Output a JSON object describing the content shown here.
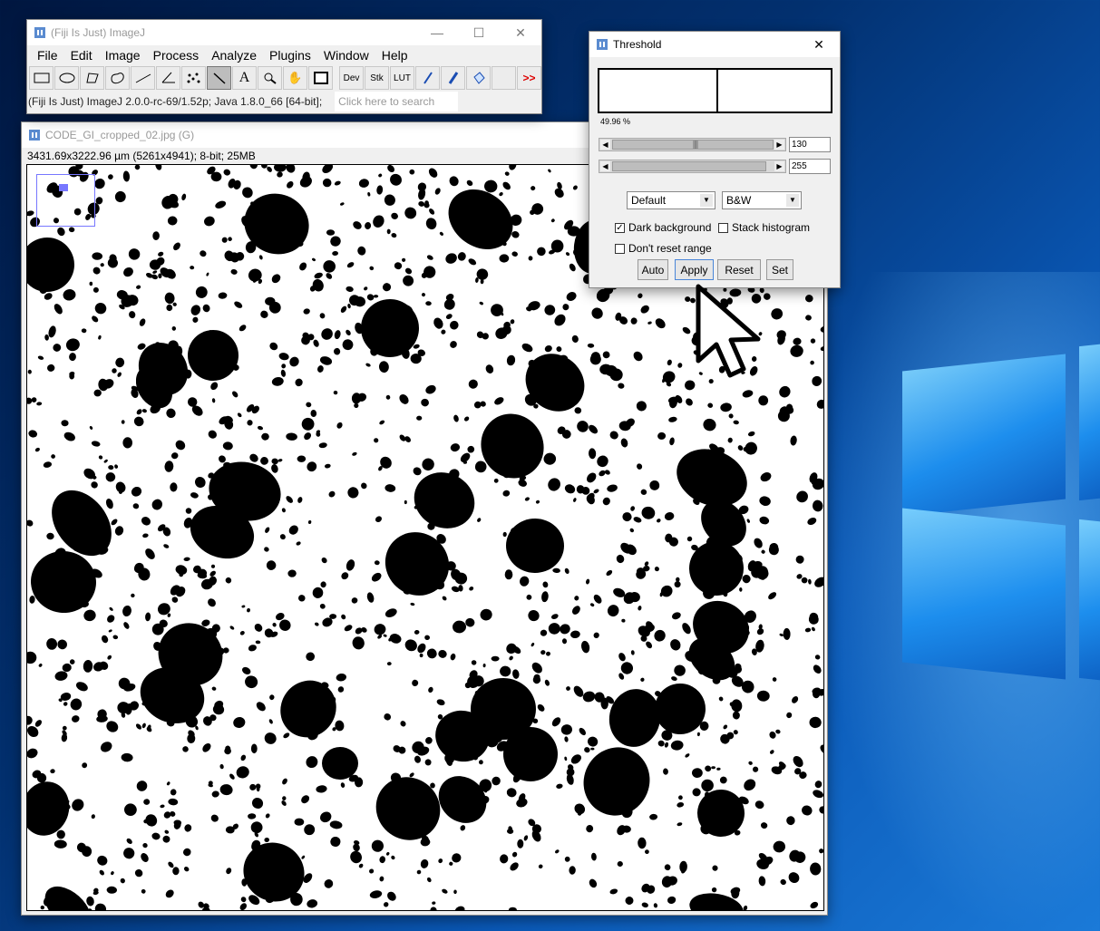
{
  "desktop": {
    "accent": "#0a58b6"
  },
  "imagej": {
    "title": "(Fiji Is Just) ImageJ",
    "menus": [
      "File",
      "Edit",
      "Image",
      "Process",
      "Analyze",
      "Plugins",
      "Window",
      "Help"
    ],
    "tools": [
      "rectangle-icon",
      "oval-icon",
      "polygon-icon",
      "freehand-icon",
      "line-icon",
      "angle-icon",
      "multipoint-icon",
      "wand-icon",
      "text-icon",
      "magnifier-icon",
      "hand-icon",
      "color-picker-icon",
      "Dev",
      "Stk",
      "LUT",
      "pencil-icon",
      "brush-icon",
      "flood-fill-icon",
      "more-tools-icon"
    ],
    "status": "(Fiji Is Just) ImageJ 2.0.0-rc-69/1.52p; Java 1.8.0_66 [64-bit];",
    "search_placeholder": "Click here to search",
    "dev_label": "Dev",
    "stk_label": "Stk",
    "lut_label": "LUT",
    "more_label": ">>"
  },
  "image_window": {
    "title": "CODE_GI_cropped_02.jpg (G)",
    "info": "3431.69x3222.96 µm (5261x4941); 8-bit; 25MB"
  },
  "threshold": {
    "title": "Threshold",
    "percent": "49.96 %",
    "min_value": "130",
    "max_value": "255",
    "method": "Default",
    "display": "B&W",
    "dark_background_label": "Dark background",
    "dark_background_checked": true,
    "stack_histogram_label": "Stack histogram",
    "stack_histogram_checked": false,
    "dont_reset_label": "Don't reset range",
    "dont_reset_checked": false,
    "buttons": {
      "auto": "Auto",
      "apply": "Apply",
      "reset": "Reset",
      "set": "Set"
    }
  }
}
